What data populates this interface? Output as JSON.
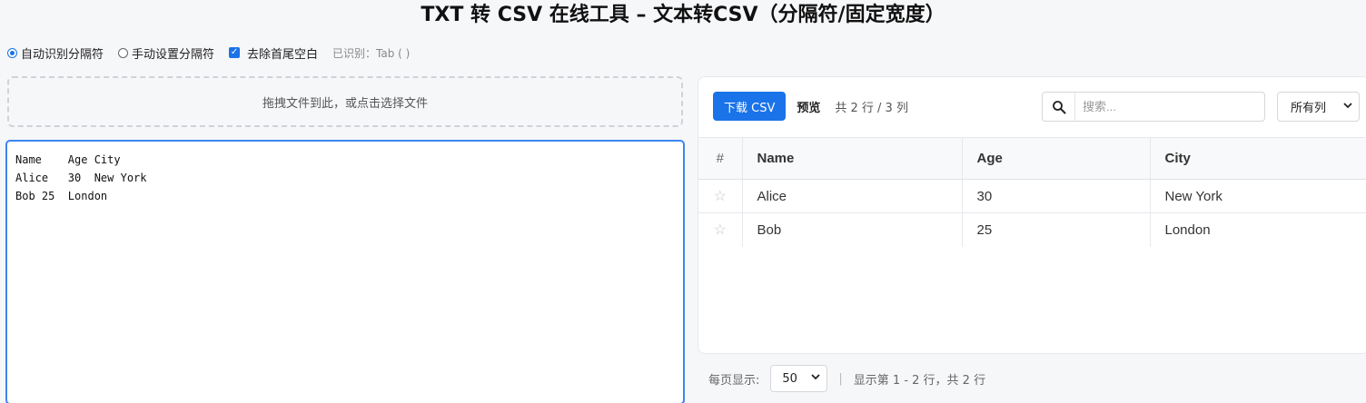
{
  "title": "TXT 转 CSV 在线工具 – 文本转CSV（分隔符/固定宽度）",
  "options": {
    "auto_detect": "自动识别分隔符",
    "manual": "手动设置分隔符",
    "trim": "去除首尾空白",
    "detected": "已识别：Tab ( )"
  },
  "dropzone": {
    "text": "拖拽文件到此，或点击选择文件"
  },
  "editor": {
    "lines": [
      "Name    Age City",
      "Alice   30  New York",
      "Bob 25  London"
    ]
  },
  "toolbar": {
    "download_label": "下载 CSV",
    "preview_label": "预览",
    "count_text": "共 2 行 / 3 列"
  },
  "search": {
    "placeholder": "搜索..."
  },
  "column_filter": {
    "selected": "所有列"
  },
  "table": {
    "headers": [
      "#",
      "Name",
      "Age",
      "City"
    ],
    "rows": [
      {
        "star": "☆",
        "name": "Alice",
        "age": "30",
        "city": "New York"
      },
      {
        "star": "☆",
        "name": "Bob",
        "age": "25",
        "city": "London"
      }
    ]
  },
  "pagination": {
    "per_page_label": "每页显示:",
    "per_page_value": "50",
    "separator": "|",
    "summary": "显示第 1 - 2 行，共 2 行"
  },
  "colors": {
    "accent": "#1a73e8",
    "editor_border": "#3d86f0"
  },
  "icons": {
    "search": "search-icon",
    "star": "star-icon",
    "dropdown": "chevron-down-icon"
  }
}
